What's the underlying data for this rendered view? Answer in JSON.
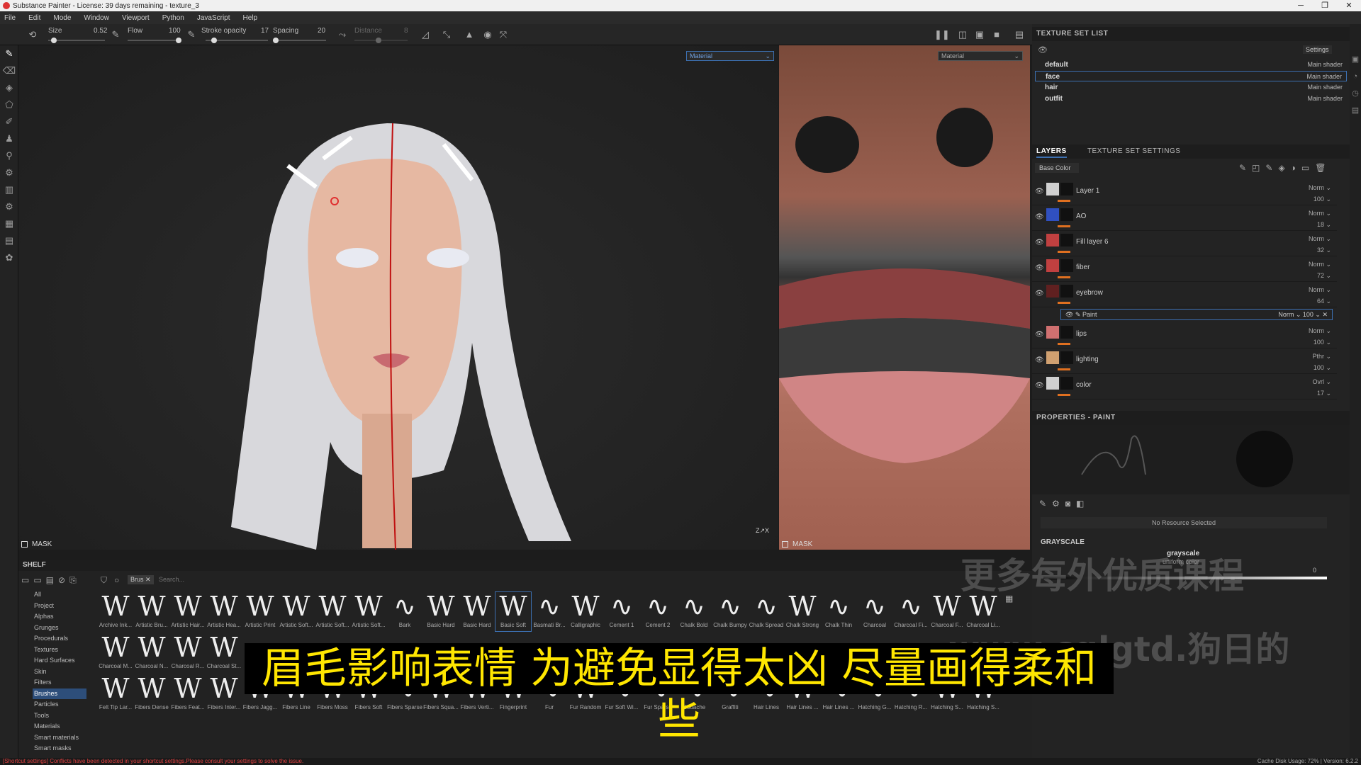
{
  "window": {
    "title": "Substance Painter - License: 39 days remaining - texture_3"
  },
  "menu": [
    "File",
    "Edit",
    "Mode",
    "Window",
    "Viewport",
    "Python",
    "JavaScript",
    "Help"
  ],
  "toolbar": {
    "size_label": "Size",
    "size_value": "0.52",
    "flow_label": "Flow",
    "flow_value": "100",
    "stroke_label": "Stroke opacity",
    "stroke_value": "17",
    "spacing_label": "Spacing",
    "spacing_value": "20",
    "distance_label": "Distance",
    "distance_value": "8"
  },
  "viewport3d": {
    "mode": "Material",
    "mask_label": "MASK"
  },
  "viewport2d": {
    "mode": "Material",
    "mask_label": "MASK"
  },
  "texture_set_list": {
    "title": "TEXTURE SET LIST",
    "settings": "Settings",
    "sets": [
      {
        "name": "default",
        "shader": "Main shader"
      },
      {
        "name": "face",
        "shader": "Main shader"
      },
      {
        "name": "hair",
        "shader": "Main shader"
      },
      {
        "name": "outfit",
        "shader": "Main shader"
      }
    ]
  },
  "layers_panel": {
    "tab_layers": "LAYERS",
    "tab_settings": "TEXTURE SET SETTINGS",
    "channel": "Base Color",
    "layers": [
      {
        "name": "Layer 1",
        "blend": "Norm",
        "opacity": "100",
        "color": "#d0d0d0"
      },
      {
        "name": "AO",
        "blend": "Norm",
        "opacity": "18",
        "color": "#3050c0"
      },
      {
        "name": "Fill layer 6",
        "blend": "Norm",
        "opacity": "32",
        "color": "#c04040"
      },
      {
        "name": "fiber",
        "blend": "Norm",
        "opacity": "72",
        "color": "#c04040"
      },
      {
        "name": "eyebrow",
        "blend": "Norm",
        "opacity": "64",
        "color": "#602020"
      },
      {
        "name": "lips",
        "blend": "Norm",
        "opacity": "100",
        "color": "#d07070"
      },
      {
        "name": "lighting",
        "blend": "Pthr",
        "opacity": "100",
        "color": "#d0a070"
      },
      {
        "name": "color",
        "blend": "Ovrl",
        "opacity": "17",
        "color": "#d0d0d0"
      }
    ],
    "sub_effect": {
      "name": "Paint",
      "blend": "Norm",
      "opacity": "100"
    }
  },
  "properties": {
    "title": "PROPERTIES - PAINT",
    "no_resource": "No Resource Selected",
    "section": "GRAYSCALE",
    "param": "grayscale",
    "param_sub": "uniform color",
    "value": "0"
  },
  "shelf": {
    "title": "SHELF",
    "filter_tag": "Brus",
    "search_placeholder": "Search...",
    "categories": [
      "All",
      "Project",
      "Alphas",
      "Grunges",
      "Procedurals",
      "Textures",
      "Hard Surfaces",
      "Skin",
      "Filters",
      "Brushes",
      "Particles",
      "Tools",
      "Materials",
      "Smart materials",
      "Smart masks"
    ],
    "row1": [
      "Archive Ink...",
      "Artistic Bru...",
      "Artistic Hair...",
      "Artistic Hea...",
      "Artistic Print",
      "Artistic Soft...",
      "Artistic Soft...",
      "Artistic Soft...",
      "Bark",
      "Basic Hard",
      "Basic Hard",
      "Basic Soft",
      "Basmati Br...",
      "Calligraphic",
      "Cement 1",
      "Cement 2",
      "Chalk Bold",
      "Chalk Bumpy",
      "Chalk Spread",
      "Chalk Strong",
      "Chalk Thin",
      "Charcoal",
      "Charcoal Fi...",
      "Charcoal F...",
      "Charcoal Li..."
    ],
    "row2": [
      "Charcoal M...",
      "Charcoal N...",
      "Charcoal R...",
      "Charcoal St..."
    ],
    "row3": [
      "Felt Tip Lar...",
      "Fibers Dense",
      "Fibers Feat...",
      "Fibers Inter...",
      "Fibers Jagg...",
      "Fibers Line",
      "Fibers Moss",
      "Fibers Soft",
      "Fibers Sparse",
      "Fibers Squa...",
      "Fibers Verti...",
      "Fingerprint",
      "Fur",
      "Fur Random",
      "Fur Soft Wi...",
      "Fur Sparse",
      "Gouache",
      "Graffiti",
      "Hair Lines",
      "Hair Lines ...",
      "Hair Lines ...",
      "Hatching G...",
      "Hatching R...",
      "Hatching S...",
      "Hatching S..."
    ]
  },
  "subtitle": "眉毛影响表情 为避免显得太凶 尽量画得柔和些",
  "watermark": "更多每外优质课程",
  "watermark2": "www.cglgtd.狗日的",
  "status": {
    "warning": "[Shortcut settings] Conflicts have been detected in your shortcut settings.Please consult your settings to solve the issue.",
    "right": "Cache Disk Usage:   72% | Version: 6.2.2"
  },
  "colors": {
    "accent": "#3c6fb0",
    "orange": "#e07020",
    "subtitle": "#ffe600"
  }
}
